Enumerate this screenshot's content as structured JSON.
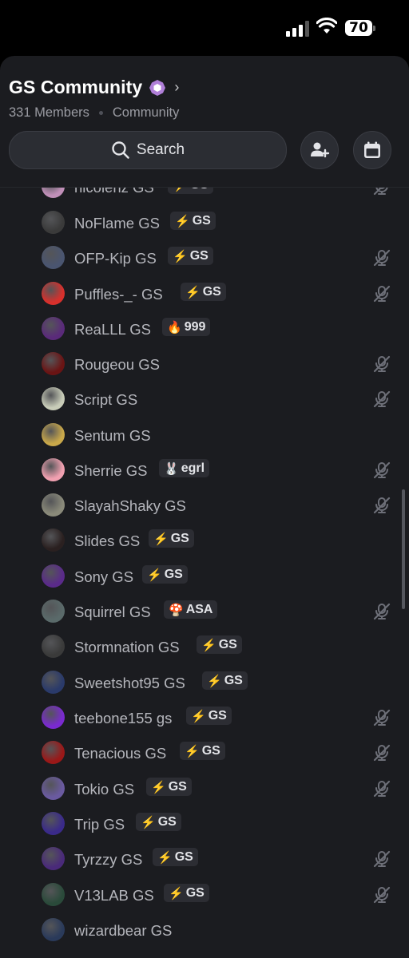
{
  "status_bar": {
    "battery": "70"
  },
  "server": {
    "name": "GS Community",
    "members": "331 Members",
    "type": "Community"
  },
  "search": {
    "label": "Search"
  },
  "colors": {
    "sheet": "#1b1c20",
    "tag_bg": "#2c2d33",
    "boost": "#b07fd8",
    "name": "#b5b6bc"
  },
  "members": [
    {
      "name": "nicolenz GS",
      "tag_icon": "⚡",
      "tag": "GS",
      "muted": true,
      "avatar": "#c08fb8"
    },
    {
      "name": "NoFlame GS",
      "tag_icon": "⚡",
      "tag": "GS",
      "muted": false,
      "avatar": "#3a3a3a"
    },
    {
      "name": "OFP-Kip GS",
      "tag_icon": "⚡",
      "tag": "GS",
      "muted": true,
      "avatar": "#4a5570"
    },
    {
      "name": "Puffles-_- GS",
      "tag_icon": "⚡",
      "tag": "GS",
      "muted": true,
      "avatar": "#d8302c"
    },
    {
      "name": "ReaLLL GS",
      "tag_icon": "🔥",
      "tag": "999",
      "muted": false,
      "avatar": "#5a2a7a"
    },
    {
      "name": "Rougeou GS",
      "tag_icon": "",
      "tag": "",
      "muted": true,
      "avatar": "#6a1414"
    },
    {
      "name": "Script GS",
      "tag_icon": "",
      "tag": "",
      "muted": true,
      "avatar": "#c8ccb8"
    },
    {
      "name": "Sentum GS",
      "tag_icon": "",
      "tag": "",
      "muted": false,
      "avatar": "#c9a84a"
    },
    {
      "name": "Sherrie GS",
      "tag_icon": "🐰",
      "tag": "egrl",
      "muted": true,
      "avatar": "#f0a0b0"
    },
    {
      "name": "SlayahShaky GS",
      "tag_icon": "",
      "tag": "",
      "muted": true,
      "avatar": "#8a8a7a"
    },
    {
      "name": "Slides GS",
      "tag_icon": "⚡",
      "tag": "GS",
      "muted": false,
      "avatar": "#2a2020"
    },
    {
      "name": "Sony GS",
      "tag_icon": "⚡",
      "tag": "GS",
      "muted": false,
      "avatar": "#5a2a8a"
    },
    {
      "name": "Squirrel GS",
      "tag_icon": "🍄",
      "tag": "ASA",
      "muted": true,
      "avatar": "#5a6a6a"
    },
    {
      "name": "Stormnation GS",
      "tag_icon": "⚡",
      "tag": "GS",
      "muted": false,
      "avatar": "#3a3a3a"
    },
    {
      "name": "Sweetshot95 GS",
      "tag_icon": "⚡",
      "tag": "GS",
      "muted": false,
      "avatar": "#2a3a6a"
    },
    {
      "name": "teebone155 gs",
      "tag_icon": "⚡",
      "tag": "GS",
      "muted": true,
      "avatar": "#7a2ad0"
    },
    {
      "name": "Tenacious GS",
      "tag_icon": "⚡",
      "tag": "GS",
      "muted": true,
      "avatar": "#9a1818"
    },
    {
      "name": "Tokio GS",
      "tag_icon": "⚡",
      "tag": "GS",
      "muted": true,
      "avatar": "#6a5aa0"
    },
    {
      "name": "Trip GS",
      "tag_icon": "⚡",
      "tag": "GS",
      "muted": false,
      "avatar": "#3a2a8a"
    },
    {
      "name": "Tyrzzy GS",
      "tag_icon": "⚡",
      "tag": "GS",
      "muted": true,
      "avatar": "#4a2a7a"
    },
    {
      "name": "V13LAB GS",
      "tag_icon": "⚡",
      "tag": "GS",
      "muted": true,
      "avatar": "#2a4a3a"
    },
    {
      "name": "wizardbear GS",
      "tag_icon": "",
      "tag": "",
      "muted": false,
      "avatar": "#2a3a5a"
    }
  ]
}
